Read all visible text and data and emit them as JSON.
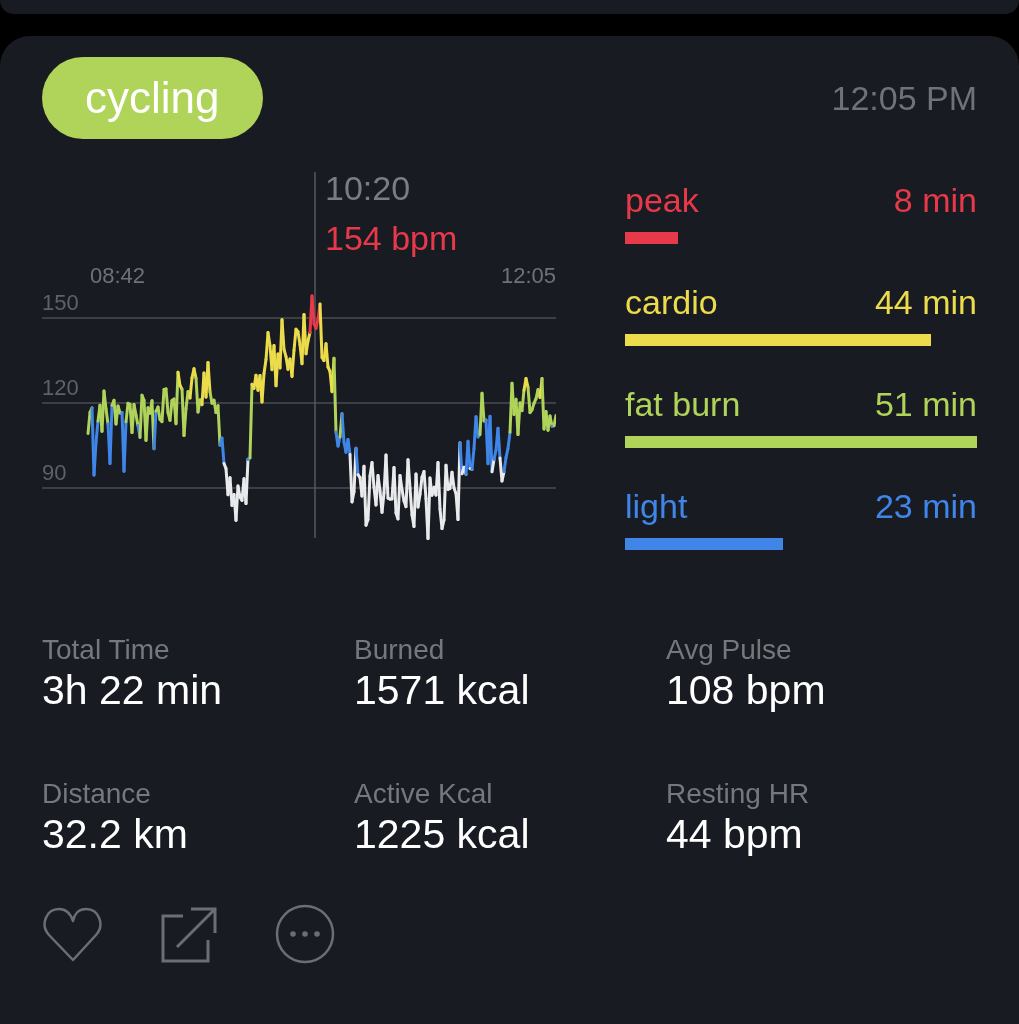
{
  "activity": {
    "label": "cycling",
    "time": "12:05 PM"
  },
  "chart": {
    "cursor_time": "10:20",
    "cursor_value": "154 bpm",
    "start_time": "08:42",
    "end_time": "12:05",
    "gridlines": [
      "150",
      "120",
      "90"
    ]
  },
  "zones": [
    {
      "name": "peak",
      "duration": "8 min",
      "level": 0.15,
      "color": "#e8394a"
    },
    {
      "name": "cardio",
      "duration": "44 min",
      "level": 0.87,
      "color": "#ecdc4c"
    },
    {
      "name": "fat burn",
      "duration": "51 min",
      "level": 1,
      "color": "#b0d35a"
    },
    {
      "name": "light",
      "duration": "23 min",
      "level": 0.45,
      "color": "#3f86e8"
    }
  ],
  "stats": [
    {
      "label": "Total Time",
      "value": "3h 22 min"
    },
    {
      "label": "Burned",
      "value": "1571 kcal"
    },
    {
      "label": "Avg Pulse",
      "value": "108 bpm"
    },
    {
      "label": "Distance",
      "value": "32.2 km"
    },
    {
      "label": "Active Kcal",
      "value": "1225 kcal"
    },
    {
      "label": "Resting HR",
      "value": "44 bpm"
    }
  ],
  "actions": [
    {
      "kind": "like"
    },
    {
      "kind": "share"
    },
    {
      "kind": "more"
    }
  ]
}
